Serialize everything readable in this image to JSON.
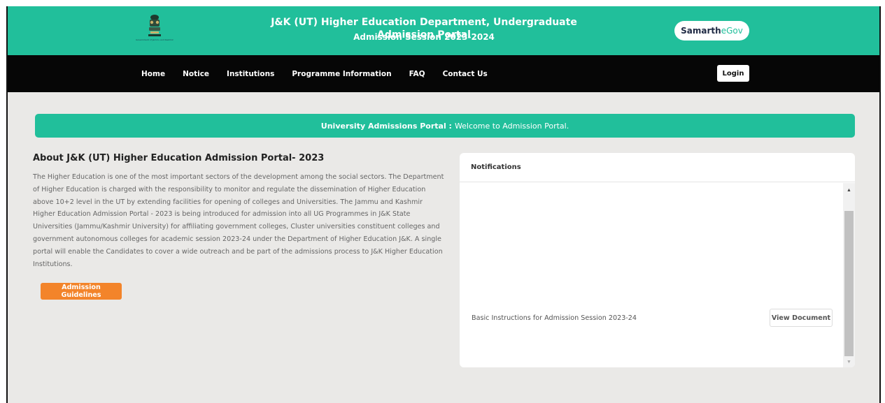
{
  "header": {
    "emblem_caption": "Government of Jammu and Kashmir",
    "title": "J&K (UT) Higher Education Department, Undergraduate Admission Portal",
    "subtitle": "Admission Session 2023-2024",
    "brand_part1": "Samarth",
    "brand_part2": "eGov"
  },
  "nav": {
    "items": [
      "Home",
      "Notice",
      "Institutions",
      "Programme Information",
      "FAQ",
      "Contact Us"
    ],
    "login_label": "Login"
  },
  "banner": {
    "strong": "University Admissions Portal :",
    "text": "Welcome to Admission Portal."
  },
  "about": {
    "heading": "About J&K (UT) Higher Education Admission Portal- 2023",
    "body": "The Higher Education is one of the most important sectors of the development among the social sectors. The Department of Higher Education is charged with the responsibility to monitor and regulate the dissemination of Higher Education above 10+2 level in the UT by extending facilities for opening of colleges and Universities. The Jammu and Kashmir Higher Education Admission Portal - 2023 is being introduced for admission into all UG Programmes in J&K State Universities (Jammu/Kashmir University) for affiliating government colleges, Cluster universities constituent colleges and government autonomous colleges for academic session 2023-24 under the Department of Higher Education J&K. A single portal will enable the Candidates to cover a wide outreach and be part of the admissions process to J&K Higher Education Institutions.",
    "button_label": "Admission Guidelines"
  },
  "notifications": {
    "heading": "Notifications",
    "items": [
      {
        "text": "Basic Instructions for Admission Session 2023-24",
        "button": "View Document"
      }
    ]
  },
  "colors": {
    "accent": "#21bf9b",
    "nav_bg": "#060606",
    "orange": "#f3842a",
    "page_bg": "#eae9e7"
  }
}
